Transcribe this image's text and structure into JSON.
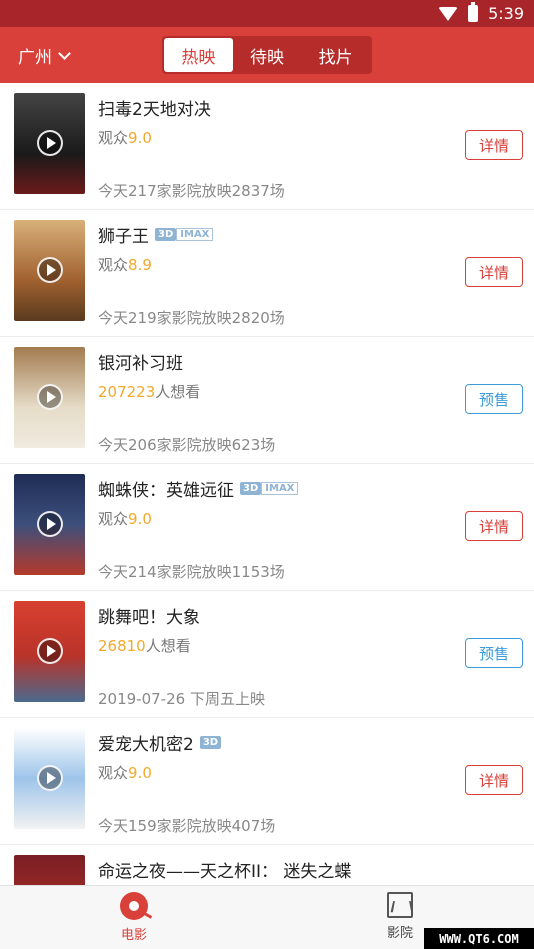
{
  "status_bar": {
    "time": "5:39"
  },
  "header": {
    "city": "广州",
    "tabs": [
      {
        "label": "热映",
        "active": true
      },
      {
        "label": "待映",
        "active": false
      },
      {
        "label": "找片",
        "active": false
      }
    ]
  },
  "movies": [
    {
      "title": "扫毒2天地对决",
      "score_label": "观众",
      "score": "9.0",
      "button": "详情",
      "button_type": "detail",
      "shows": "今天217家影院放映2837场",
      "tags": [],
      "poster_color": "#2b2b2b"
    },
    {
      "title": "狮子王",
      "score_label": "观众",
      "score": "8.9",
      "button": "详情",
      "button_type": "detail",
      "shows": "今天219家影院放映2820场",
      "tags": [
        "3D",
        "IMAX"
      ],
      "poster_color": "#b5733c"
    },
    {
      "title": "银河补习班",
      "want_count": "207223",
      "want_label": "人想看",
      "button": "预售",
      "button_type": "presale",
      "shows": "今天206家影院放映623场",
      "tags": [],
      "poster_color": "#c9b79a"
    },
    {
      "title": "蜘蛛侠：英雄远征",
      "score_label": "观众",
      "score": "9.0",
      "button": "详情",
      "button_type": "detail",
      "shows": "今天214家影院放映1153场",
      "tags": [
        "3D",
        "IMAX"
      ],
      "poster_color": "#2c3f6b"
    },
    {
      "title": "跳舞吧！大象",
      "want_count": "26810",
      "want_label": "人想看",
      "button": "预售",
      "button_type": "presale",
      "shows": "2019-07-26 下周五上映",
      "tags": [],
      "poster_color": "#c9392d"
    },
    {
      "title": "爱宠大机密2",
      "score_label": "观众",
      "score": "9.0",
      "button": "详情",
      "button_type": "detail",
      "shows": "今天159家影院放映407场",
      "tags": [
        "3D"
      ],
      "poster_color": "#4a86c8"
    },
    {
      "title": "命运之夜——天之杯II： 迷失之蝶",
      "tags": [],
      "poster_color": "#6a1c22"
    }
  ],
  "bottom_nav": [
    {
      "label": "电影",
      "active": true
    },
    {
      "label": "影院",
      "active": false
    }
  ],
  "watermark": "WWW.QT6.COM",
  "colors": {
    "brand_red": "#d9403a",
    "status_red": "#a8262a",
    "score_yellow": "#f1a92c",
    "presale_blue": "#3c9cd9"
  }
}
